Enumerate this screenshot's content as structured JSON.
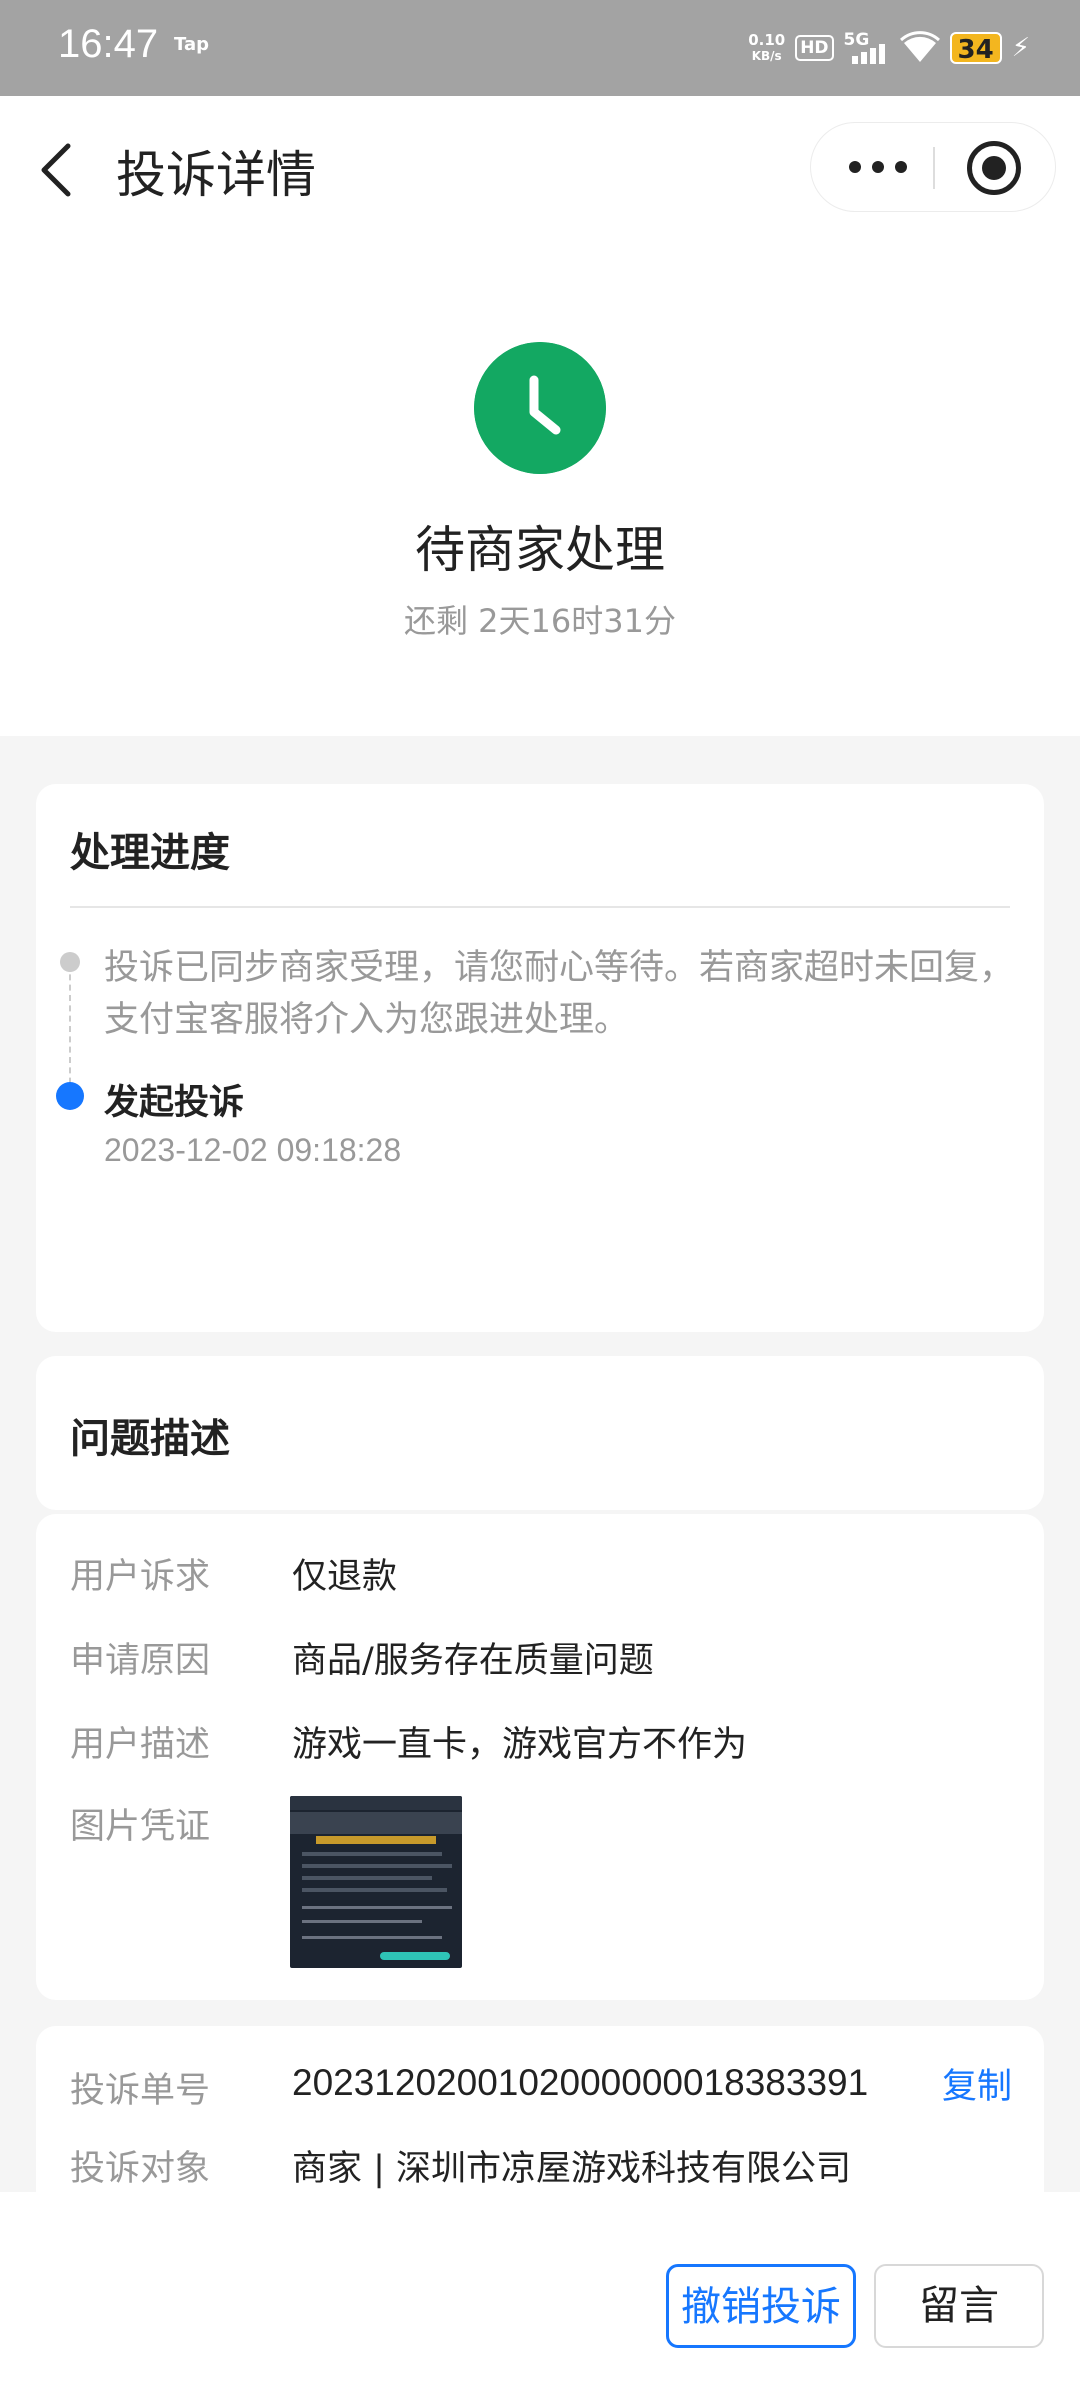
{
  "status_bar": {
    "time": "16:47",
    "carrier_badge": "Tap",
    "net_speed_value": "0.10",
    "net_speed_unit": "KB/s",
    "hd_label": "HD",
    "network_label": "5G",
    "battery_level": "34",
    "battery_color": "#f3b61f"
  },
  "header": {
    "title": "投诉详情",
    "back_icon": "chevron-left-icon",
    "more_icon": "more-dots-icon",
    "close_icon": "target-circle-icon"
  },
  "status": {
    "icon": "clock-icon",
    "icon_color": "#13a862",
    "title": "待商家处理",
    "remaining": "还剩 2天16时31分"
  },
  "progress": {
    "title": "处理进度",
    "message": "投诉已同步商家受理，请您耐心等待。若商家超时未回复，支付宝客服将介入为您跟进处理。",
    "event": "发起投诉",
    "event_time": "2023-12-02 09:18:28"
  },
  "description": {
    "title": "问题描述",
    "rows": [
      {
        "label": "用户诉求",
        "value": "仅退款"
      },
      {
        "label": "申请原因",
        "value": "商品/服务存在质量问题"
      },
      {
        "label": "用户描述",
        "value": "游戏一直卡，游戏官方不作为"
      }
    ],
    "evidence_label": "图片凭证"
  },
  "info": {
    "rows": [
      {
        "label": "投诉单号",
        "value": "2023120200102000000018383391"
      },
      {
        "label": "投诉对象",
        "value": "商家 | 深圳市凉屋游戏科技有限公司"
      }
    ],
    "copy_label": "复制"
  },
  "actions": {
    "revoke_label": "撤销投诉",
    "message_label": "留言",
    "accent_color": "#1677ff"
  }
}
